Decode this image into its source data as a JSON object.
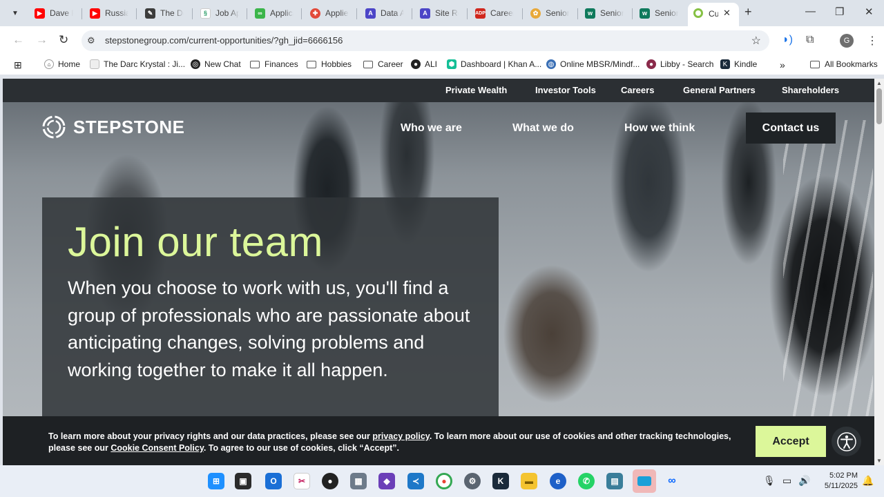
{
  "browser": {
    "tabs": [
      {
        "title": "Dave P",
        "icon": "youtube-icon",
        "color": "#ff0000"
      },
      {
        "title": "Russia",
        "icon": "youtube-icon",
        "color": "#ff0000"
      },
      {
        "title": "The De",
        "icon": "notepad-icon",
        "color": "#3c3c3c"
      },
      {
        "title": "Job Ap",
        "icon": "ai-icon",
        "color": "#2e9e6a"
      },
      {
        "title": "Applica",
        "icon": "link-icon",
        "color": "#3bb54a"
      },
      {
        "title": "Applie",
        "icon": "app-icon",
        "color": "#e24a3a"
      },
      {
        "title": "Data A",
        "icon": "letter-a-icon",
        "color": "#4b45c7"
      },
      {
        "title": "Site Re",
        "icon": "letter-a-icon",
        "color": "#4b45c7"
      },
      {
        "title": "Career",
        "icon": "adp-icon",
        "color": "#d0271d"
      },
      {
        "title": "Senior",
        "icon": "pinwheel-icon",
        "color": "#e8a93a"
      },
      {
        "title": "Senior",
        "icon": "workday-icon",
        "color": "#0f7a5c"
      },
      {
        "title": "Senior",
        "icon": "workday-icon",
        "color": "#0f7a5c"
      }
    ],
    "active_tab": {
      "title": "Cu",
      "icon": "stepstone-icon"
    },
    "url": "stepstonegroup.com/current-opportunities/?gh_jid=6666156",
    "profile_initial": "G",
    "bookmarks": [
      {
        "label": "Home",
        "icon": "home-icon"
      },
      {
        "label": "The Darc Krystal : Ji...",
        "icon": "page-icon"
      },
      {
        "label": "New Chat",
        "icon": "chat-icon"
      },
      {
        "label": "Finances",
        "icon": "folder-icon"
      },
      {
        "label": "Hobbies",
        "icon": "folder-icon"
      },
      {
        "label": "Career",
        "icon": "folder-icon"
      },
      {
        "label": "ALI",
        "icon": "github-icon"
      },
      {
        "label": "Dashboard | Khan A...",
        "icon": "khan-icon"
      },
      {
        "label": "Online MBSR/Mindf...",
        "icon": "globe-icon"
      },
      {
        "label": "Libby - Search",
        "icon": "libby-icon"
      },
      {
        "label": "Kindle",
        "icon": "kindle-icon"
      }
    ],
    "all_bookmarks": "All Bookmarks"
  },
  "site": {
    "utility_links": [
      "Private Wealth",
      "Investor Tools",
      "Careers",
      "General Partners",
      "Shareholders"
    ],
    "logo_text": "STEPSTONE",
    "main_nav": [
      "Who we are",
      "What we do",
      "How we think"
    ],
    "contact_label": "Contact us",
    "hero": {
      "title": "Join our team",
      "text": "When you choose to work with us, you'll find a group of professionals who are passionate about anticipating changes, solving problems and working together to make it all happen."
    },
    "cookie": {
      "text_1": "To learn more about your privacy rights and our data practices, please see our ",
      "link_1": "privacy policy",
      "text_2": ". To learn more about our use of cookies and other tracking technologies, please see our ",
      "link_2": "Cookie Consent Policy",
      "text_3": ". To agree to our use of cookies, click “Accept”.",
      "accept_label": "Accept"
    },
    "accent_color": "#dcf79a"
  },
  "taskbar": {
    "time": "5:02 PM",
    "date": "5/11/2025"
  }
}
